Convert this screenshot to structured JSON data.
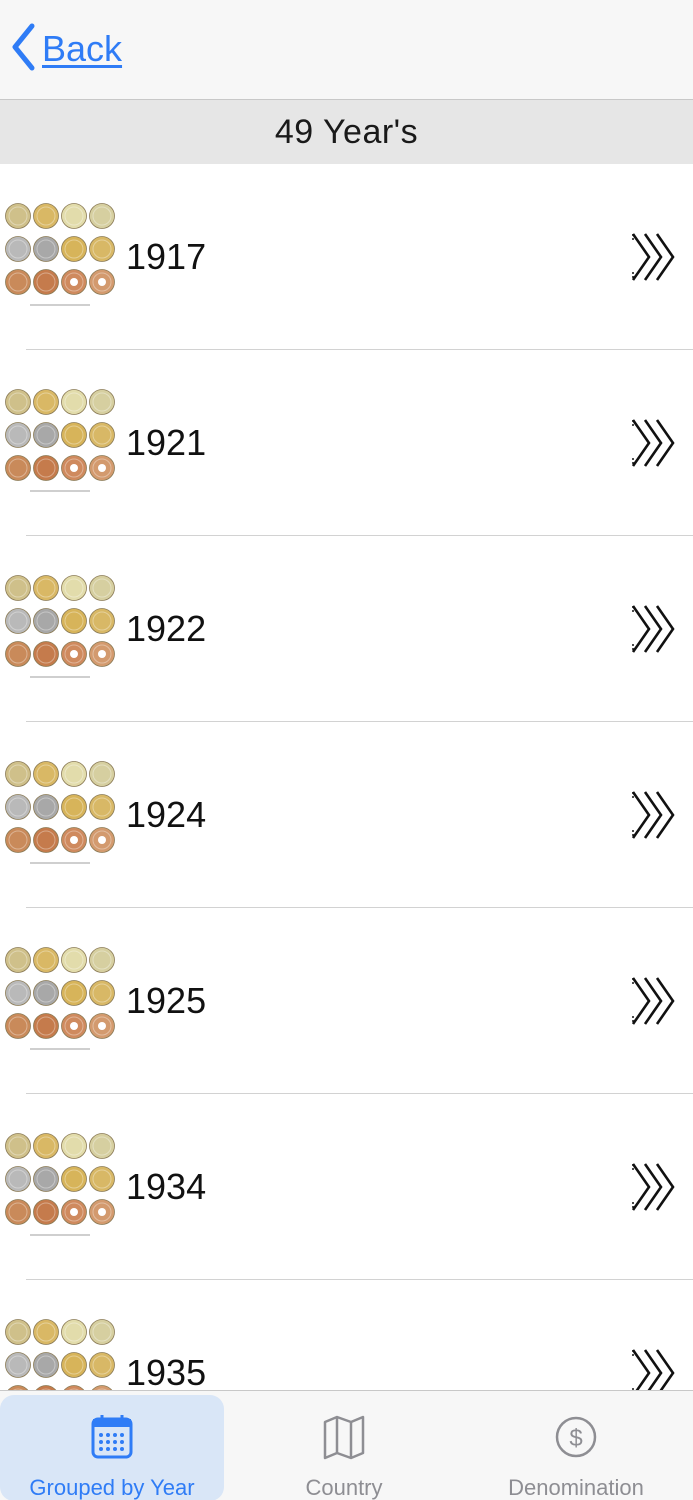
{
  "nav": {
    "back_label": "Back"
  },
  "header": {
    "title": "49 Year's"
  },
  "rows": [
    {
      "year": "1917"
    },
    {
      "year": "1921"
    },
    {
      "year": "1922"
    },
    {
      "year": "1924"
    },
    {
      "year": "1925"
    },
    {
      "year": "1934"
    },
    {
      "year": "1935"
    }
  ],
  "tabs": [
    {
      "label": "Grouped by Year",
      "icon": "calendar-icon",
      "active": true
    },
    {
      "label": "Country",
      "icon": "map-icon",
      "active": false
    },
    {
      "label": "Denomination",
      "icon": "dollar-icon",
      "active": false
    }
  ],
  "colors": {
    "accent": "#2f7cf6",
    "inactive": "#8e8e93",
    "active_tab_bg": "#d9e6f7"
  }
}
